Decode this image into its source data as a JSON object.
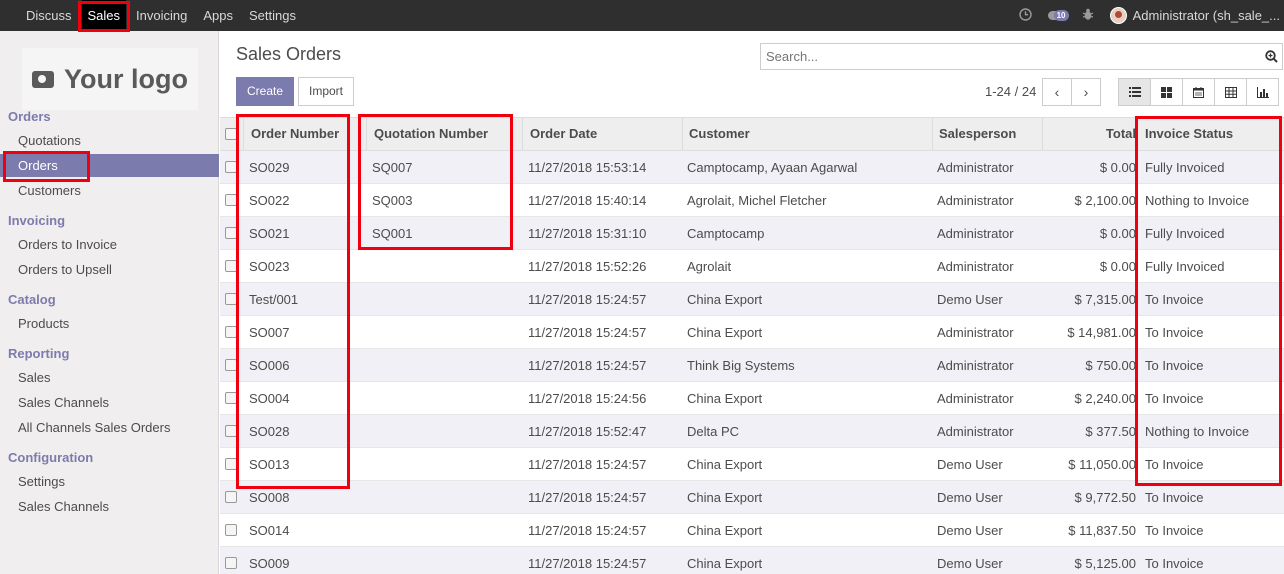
{
  "topbar": {
    "menu": [
      "Discuss",
      "Sales",
      "Invoicing",
      "Apps",
      "Settings"
    ],
    "active": "Sales",
    "messages_count": "10",
    "user": "Administrator (sh_sale_..."
  },
  "sidebar": {
    "logo_text": "Your logo",
    "sections": [
      {
        "title": "Orders",
        "items": [
          "Quotations",
          "Orders",
          "Customers"
        ]
      },
      {
        "title": "Invoicing",
        "items": [
          "Orders to Invoice",
          "Orders to Upsell"
        ]
      },
      {
        "title": "Catalog",
        "items": [
          "Products"
        ]
      },
      {
        "title": "Reporting",
        "items": [
          "Sales",
          "Sales Channels",
          "All Channels Sales Orders"
        ]
      },
      {
        "title": "Configuration",
        "items": [
          "Settings",
          "Sales Channels"
        ]
      }
    ],
    "active_item": "Orders"
  },
  "control_panel": {
    "title": "Sales Orders",
    "search_placeholder": "Search...",
    "create_label": "Create",
    "import_label": "Import",
    "pager": "1-24 / 24",
    "prev_label": "‹",
    "next_label": "›"
  },
  "table": {
    "columns": [
      "Order Number",
      "Quotation Number",
      "Order Date",
      "Customer",
      "Salesperson",
      "Total",
      "Invoice Status"
    ],
    "rows": [
      [
        "SO029",
        "SQ007",
        "11/27/2018 15:53:14",
        "Camptocamp, Ayaan Agarwal",
        "Administrator",
        "$ 0.00",
        "Fully Invoiced"
      ],
      [
        "SO022",
        "SQ003",
        "11/27/2018 15:40:14",
        "Agrolait, Michel Fletcher",
        "Administrator",
        "$ 2,100.00",
        "Nothing to Invoice"
      ],
      [
        "SO021",
        "SQ001",
        "11/27/2018 15:31:10",
        "Camptocamp",
        "Administrator",
        "$ 0.00",
        "Fully Invoiced"
      ],
      [
        "SO023",
        "",
        "11/27/2018 15:52:26",
        "Agrolait",
        "Administrator",
        "$ 0.00",
        "Fully Invoiced"
      ],
      [
        "Test/001",
        "",
        "11/27/2018 15:24:57",
        "China Export",
        "Demo User",
        "$ 7,315.00",
        "To Invoice"
      ],
      [
        "SO007",
        "",
        "11/27/2018 15:24:57",
        "China Export",
        "Administrator",
        "$ 14,981.00",
        "To Invoice"
      ],
      [
        "SO006",
        "",
        "11/27/2018 15:24:57",
        "Think Big Systems",
        "Administrator",
        "$ 750.00",
        "To Invoice"
      ],
      [
        "SO004",
        "",
        "11/27/2018 15:24:56",
        "China Export",
        "Administrator",
        "$ 2,240.00",
        "To Invoice"
      ],
      [
        "SO028",
        "",
        "11/27/2018 15:52:47",
        "Delta PC",
        "Administrator",
        "$ 377.50",
        "Nothing to Invoice"
      ],
      [
        "SO013",
        "",
        "11/27/2018 15:24:57",
        "China Export",
        "Demo User",
        "$ 11,050.00",
        "To Invoice"
      ],
      [
        "SO008",
        "",
        "11/27/2018 15:24:57",
        "China Export",
        "Demo User",
        "$ 9,772.50",
        "To Invoice"
      ],
      [
        "SO014",
        "",
        "11/27/2018 15:24:57",
        "China Export",
        "Demo User",
        "$ 11,837.50",
        "To Invoice"
      ],
      [
        "SO009",
        "",
        "11/27/2018 15:24:57",
        "China Export",
        "Demo User",
        "$ 5,125.00",
        "To Invoice"
      ]
    ]
  },
  "colors": {
    "accent": "#7c7bad",
    "annotation": "#f0000f",
    "topbar": "#2f2f2f"
  }
}
